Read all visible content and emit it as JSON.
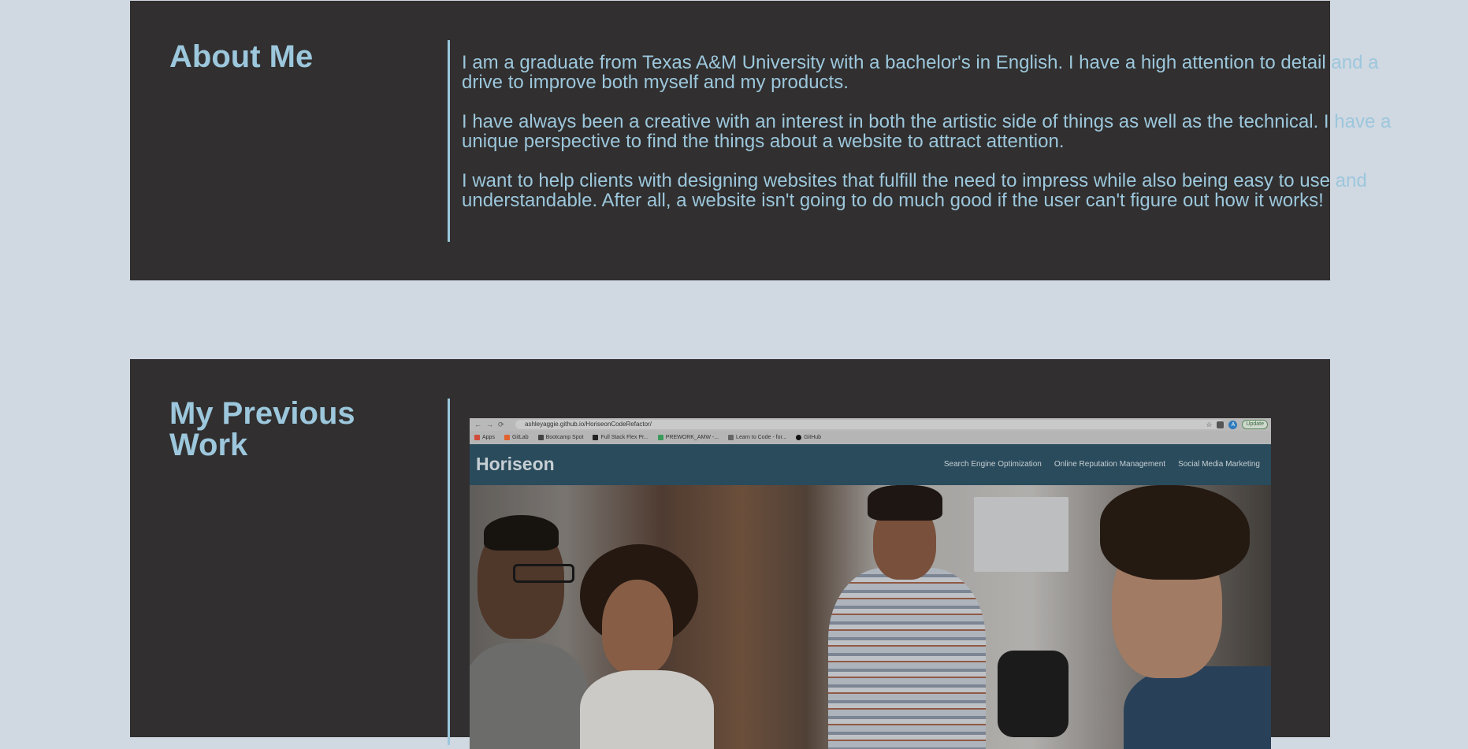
{
  "about": {
    "title": "About Me",
    "paragraphs": [
      "I am a graduate from Texas A&M University with a bachelor's in English. I have a high attention to detail and a drive to improve both myself and my products.",
      "I have always been a creative with an interest in both the artistic side of things as well as the technical. I have a unique perspective to find the things about a website to attract attention.",
      "I want to help clients with designing websites that fulfill the need to impress while also being easy to use and understandable. After all, a website isn't going to do much good if the user can't figure out how it works!"
    ]
  },
  "work": {
    "title": "My Previous Work",
    "screenshot": {
      "url": "ashleyaggie.github.io/HoriseonCodeRefactor/",
      "update_label": "Update",
      "avatar_letter": "A",
      "bookmarks": [
        "Apps",
        "GitLab",
        "Bootcamp Spot",
        "Full Stack Flex Pr...",
        "PREWORK_AMW -...",
        "Learn to Code - for...",
        "GitHub"
      ],
      "site_logo": "Horiseon",
      "site_nav": [
        "Search Engine Optimization",
        "Online Reputation Management",
        "Social Media Marketing"
      ]
    }
  },
  "colors": {
    "page_bg": "#d0d8e2",
    "section_bg": "#312f2f",
    "accent": "#9cc7dc"
  }
}
